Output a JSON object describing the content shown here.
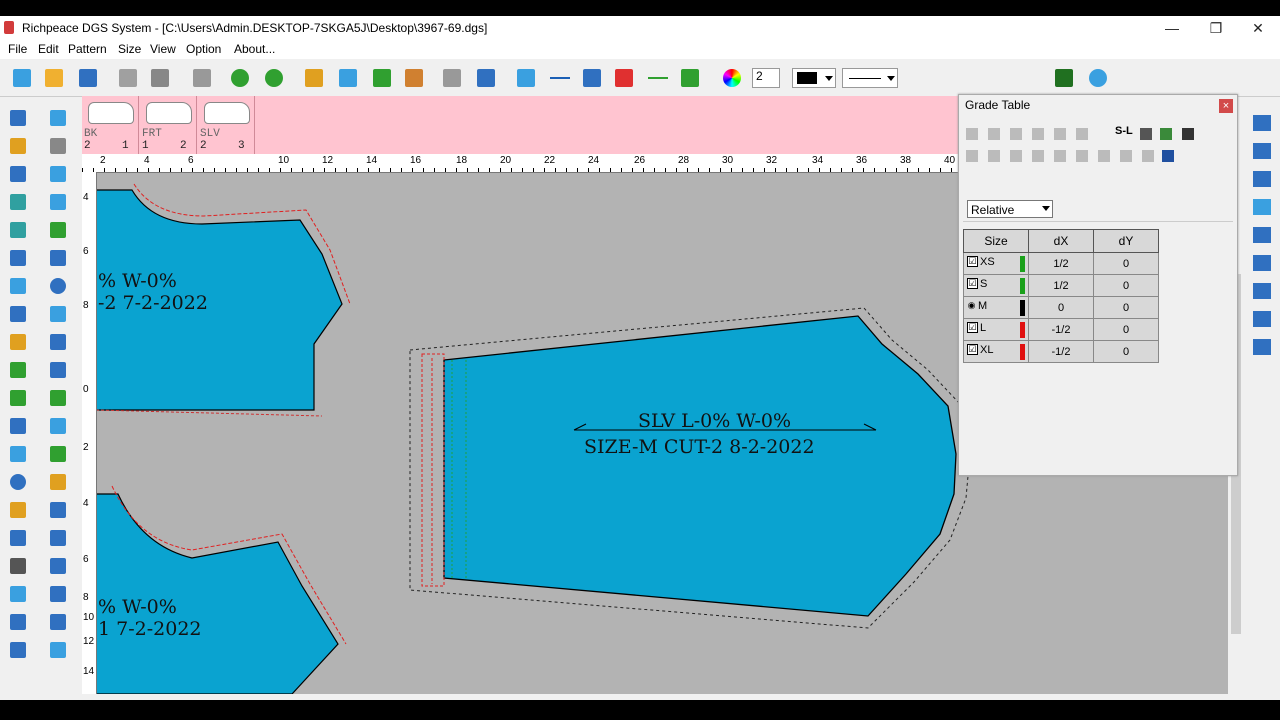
{
  "window": {
    "title": "Richpeace DGS System - [C:\\Users\\Admin.DESKTOP-7SKGA5J\\Desktop\\3967-69.dgs]",
    "min_glyph": "—",
    "restore_glyph": "❐",
    "close_glyph": "✕"
  },
  "menu": [
    "File",
    "Edit",
    "Pattern",
    "Size",
    "View",
    "Option",
    "About..."
  ],
  "toolbar": {
    "field_value": "2",
    "color_swatch": "#000000"
  },
  "pieces": [
    {
      "name": "BK",
      "qty": "2",
      "index": "1"
    },
    {
      "name": "FRT",
      "qty": "1",
      "index": "2"
    },
    {
      "name": "SLV",
      "qty": "2",
      "index": "3"
    }
  ],
  "ruler": {
    "top_ticks": [
      "2",
      "4",
      "6",
      "10",
      "12",
      "14",
      "16",
      "18",
      "20",
      "22",
      "24",
      "26",
      "28",
      "30",
      "32",
      "34",
      "36",
      "38",
      "40"
    ],
    "left_ticks": [
      "4",
      "6",
      "8",
      "0",
      "2",
      "4",
      "6",
      "8",
      "10",
      "12",
      "14"
    ]
  },
  "canvas": {
    "piece_fill": "#0aa3d0",
    "back_label": [
      "% W-0%",
      "-2 7-2-2022"
    ],
    "front_label": [
      "% W-0%",
      "1 7-2-2022"
    ],
    "sleeve_label": [
      "SLV L-0% W-0%",
      "SIZE-M CUT-2 8-2-2022"
    ]
  },
  "grade_table": {
    "title": "Grade Table",
    "close": "×",
    "toolbar_text": "S-L",
    "mode": "Relative",
    "headers": [
      "Size",
      "dX",
      "dY"
    ],
    "rows": [
      {
        "size": "XS",
        "mark": "☑",
        "color": "#1aa01a",
        "dx": "1/2",
        "dy": "0"
      },
      {
        "size": "S",
        "mark": "☑",
        "color": "#1aa01a",
        "dx": "1/2",
        "dy": "0"
      },
      {
        "size": "M",
        "mark": "◉",
        "color": "#000000",
        "dx": "0",
        "dy": "0"
      },
      {
        "size": "L",
        "mark": "☑",
        "color": "#e01010",
        "dx": "-1/2",
        "dy": "0"
      },
      {
        "size": "XL",
        "mark": "☑",
        "color": "#e01010",
        "dx": "-1/2",
        "dy": "0"
      }
    ]
  }
}
